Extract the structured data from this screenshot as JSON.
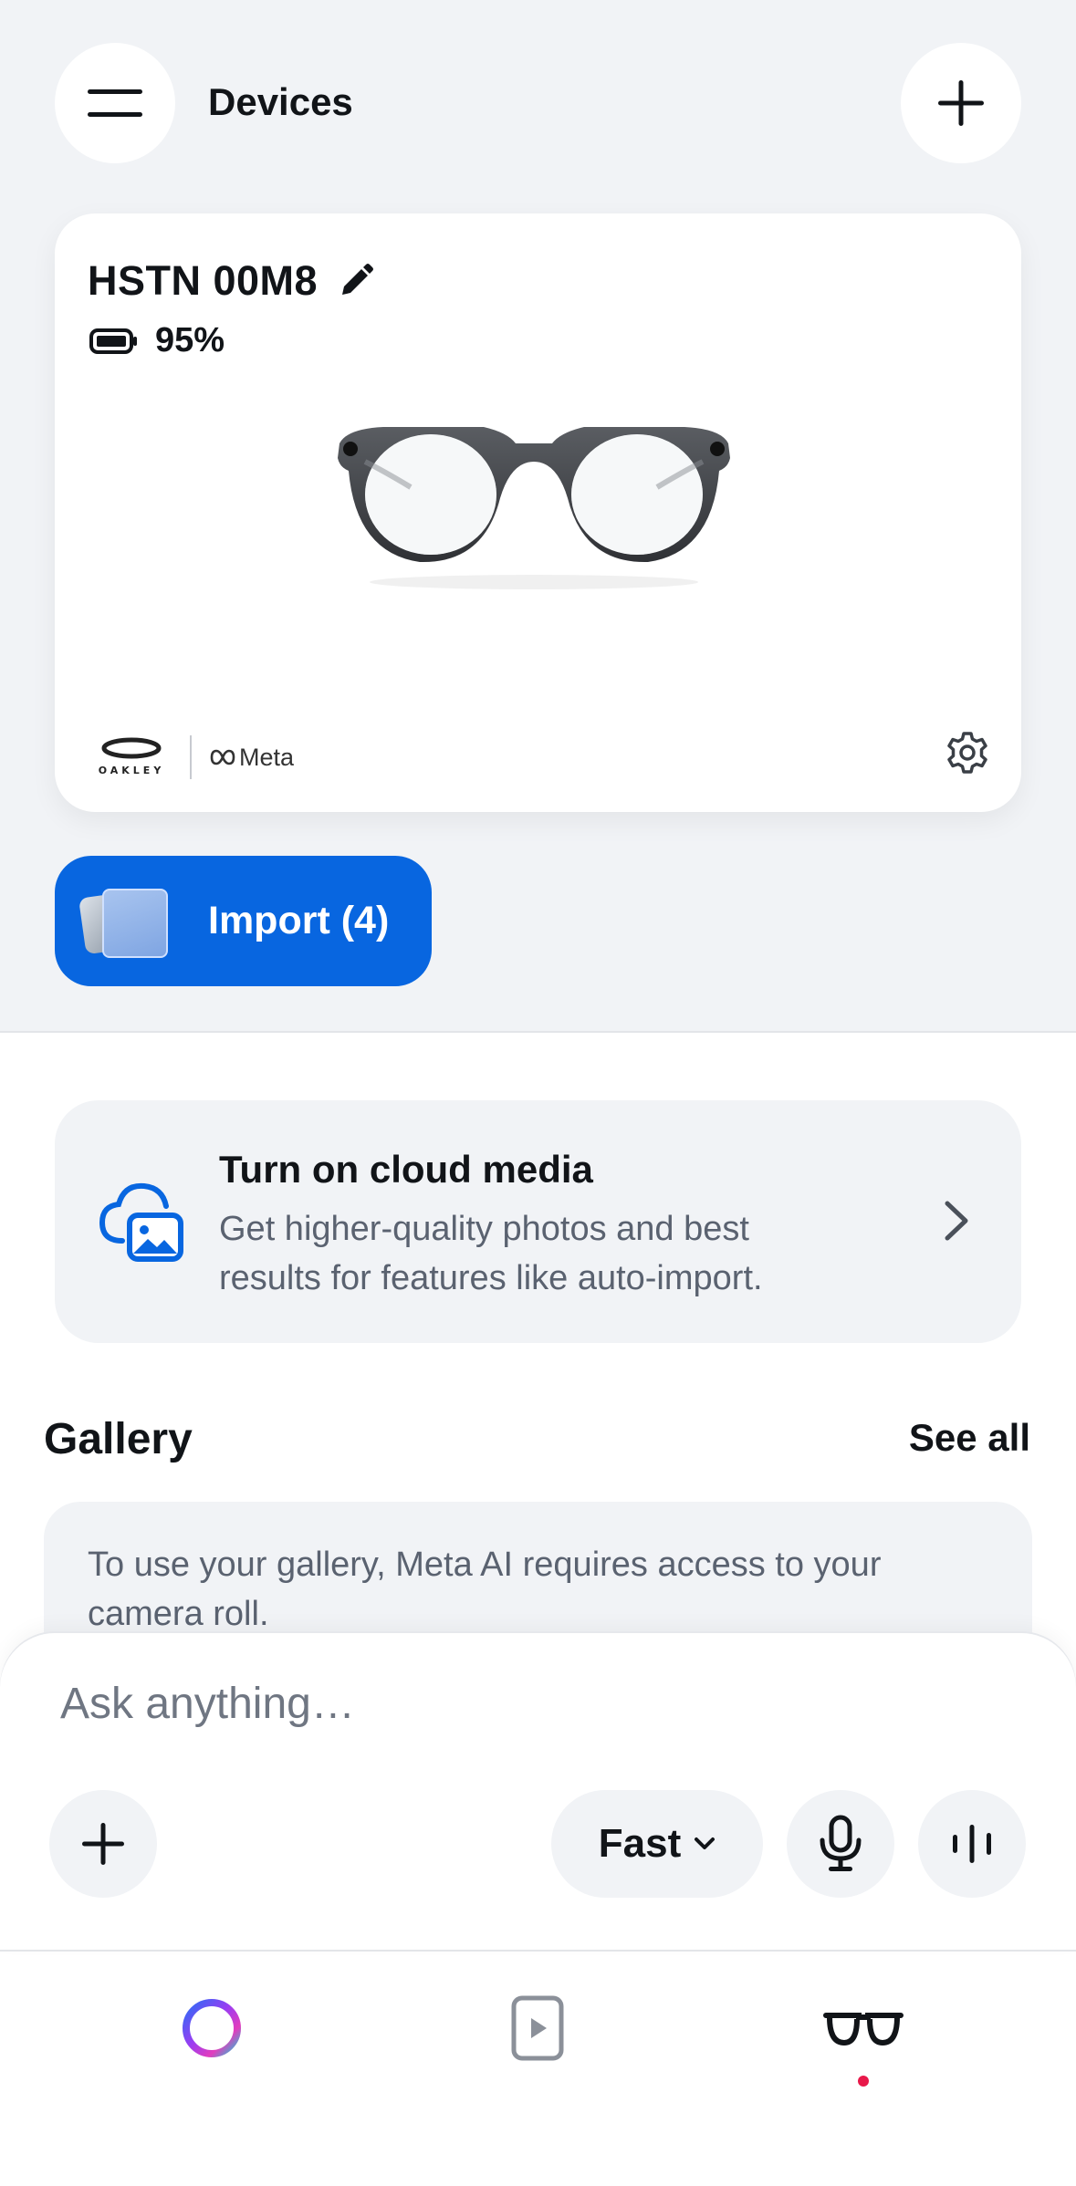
{
  "header": {
    "title": "Devices",
    "menu_icon": "hamburger-menu-icon",
    "add_icon": "plus-icon"
  },
  "device": {
    "name": "HSTN 00M8",
    "battery": "95%",
    "battery_level": 0.95,
    "brand_meta": "Meta",
    "brand_oakley": "OAKLEY"
  },
  "import": {
    "label": "Import (4)",
    "color": "#0866e0"
  },
  "cloud": {
    "title": "Turn on cloud media",
    "description": "Get higher-quality photos and best results for features like auto-import."
  },
  "gallery": {
    "title": "Gallery",
    "see_all": "See all",
    "message": "To use your gallery, Meta AI requires access to your camera roll."
  },
  "composer": {
    "placeholder": "Ask anything…",
    "mode": "Fast"
  },
  "bottom_nav": {
    "items": [
      "meta-ai-ring-icon",
      "media-play-icon",
      "glasses-icon"
    ],
    "active_index": 2,
    "active_dot_color": "#e8194a"
  }
}
